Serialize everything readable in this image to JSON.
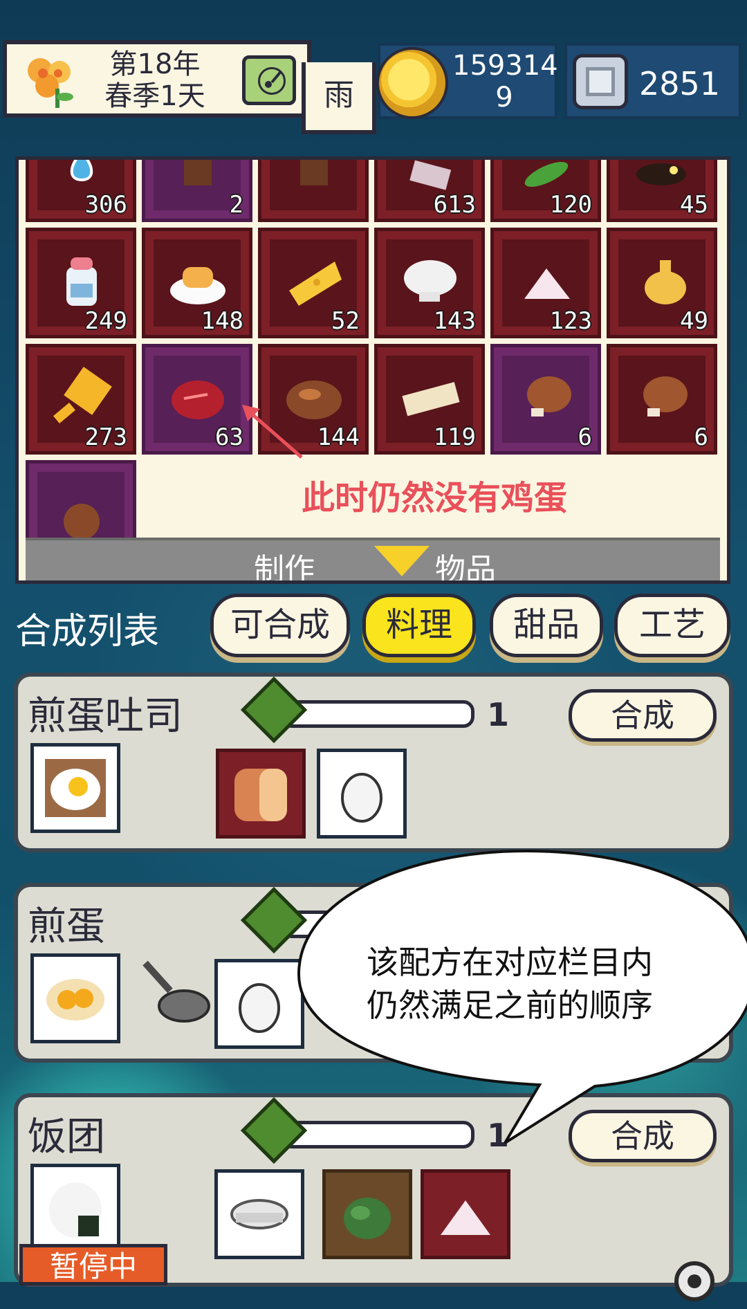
{
  "hud": {
    "date_line1": "第18年",
    "date_line2": "春季1天",
    "weather": "雨",
    "money_line1": "159314",
    "money_line2": "9",
    "gems": "2851"
  },
  "inventory": {
    "rows": [
      [
        "306",
        "2",
        "",
        "613",
        "120",
        "45"
      ],
      [
        "249",
        "148",
        "52",
        "143",
        "123",
        "49"
      ],
      [
        "273",
        "63",
        "144",
        "119",
        "6",
        "6"
      ]
    ],
    "annotation": "此时仍然没有鸡蛋",
    "craft_left": "制作",
    "craft_right": "物品"
  },
  "tabs": {
    "title": "合成列表",
    "items": [
      "可合成",
      "料理",
      "甜品",
      "工艺"
    ],
    "active": "料理"
  },
  "recipes": [
    {
      "name": "煎蛋吐司",
      "qty": "1",
      "button": "合成"
    },
    {
      "name": "煎蛋",
      "qty": "",
      "button": ""
    },
    {
      "name": "饭团",
      "qty": "1",
      "button": "合成"
    }
  ],
  "bubble": {
    "line1": "该配方在对应栏目内",
    "line2": "仍然满足之前的顺序"
  },
  "pause": "暂停中",
  "colors": {
    "annotation": "#e9505a",
    "active_tab": "#f9e41e",
    "slot_red": "#7d1f27",
    "slot_purple": "#6e2a6a"
  }
}
